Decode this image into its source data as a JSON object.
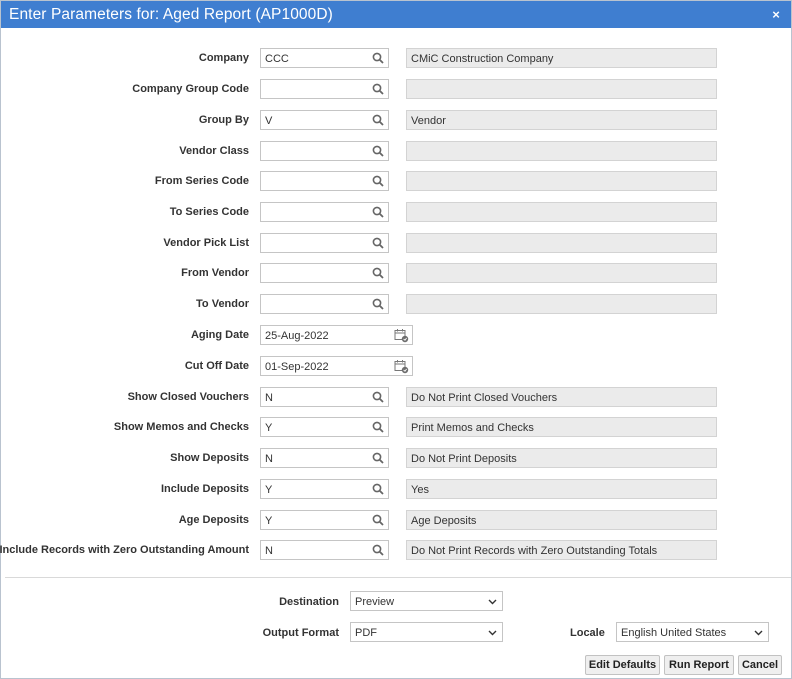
{
  "dialog": {
    "title": "Enter Parameters for: Aged Report (AP1000D)",
    "close_glyph": "×"
  },
  "params": {
    "company": {
      "label": "Company",
      "value": "CCC",
      "desc": "CMiC Construction Company"
    },
    "company_group": {
      "label": "Company Group Code",
      "value": "",
      "desc": ""
    },
    "group_by": {
      "label": "Group By",
      "value": "V",
      "desc": "Vendor"
    },
    "vendor_class": {
      "label": "Vendor Class",
      "value": "",
      "desc": ""
    },
    "from_series": {
      "label": "From Series Code",
      "value": "",
      "desc": ""
    },
    "to_series": {
      "label": "To Series Code",
      "value": "",
      "desc": ""
    },
    "vendor_pick_list": {
      "label": "Vendor Pick List",
      "value": "",
      "desc": ""
    },
    "from_vendor": {
      "label": "From Vendor",
      "value": "",
      "desc": ""
    },
    "to_vendor": {
      "label": "To Vendor",
      "value": "",
      "desc": ""
    },
    "aging_date": {
      "label": "Aging Date",
      "value": "25-Aug-2022"
    },
    "cut_off_date": {
      "label": "Cut Off Date",
      "value": "01-Sep-2022"
    },
    "show_closed_vouchers": {
      "label": "Show Closed Vouchers",
      "value": "N",
      "desc": "Do Not Print Closed Vouchers"
    },
    "show_memos_checks": {
      "label": "Show Memos and Checks",
      "value": "Y",
      "desc": "Print Memos and Checks"
    },
    "show_deposits": {
      "label": "Show Deposits",
      "value": "N",
      "desc": "Do Not Print Deposits"
    },
    "include_deposits": {
      "label": "Include Deposits",
      "value": "Y",
      "desc": "Yes"
    },
    "age_deposits": {
      "label": "Age Deposits",
      "value": "Y",
      "desc": "Age Deposits"
    },
    "include_zero": {
      "label": "Include Records with Zero Outstanding Amount",
      "value": "N",
      "desc": "Do Not Print Records with Zero Outstanding Totals"
    }
  },
  "output": {
    "destination_label": "Destination",
    "destination_value": "Preview",
    "format_label": "Output Format",
    "format_value": "PDF",
    "locale_label": "Locale",
    "locale_value": "English United States"
  },
  "buttons": {
    "edit_defaults": "Edit Defaults",
    "run_report": "Run Report",
    "cancel": "Cancel"
  },
  "icons": {
    "lookup": "search-icon",
    "date": "calendar-icon",
    "select": "chevron-down-icon",
    "close": "close-icon"
  },
  "colors": {
    "titlebar": "#3f7ed0",
    "readonly_bg": "#ebebeb"
  }
}
